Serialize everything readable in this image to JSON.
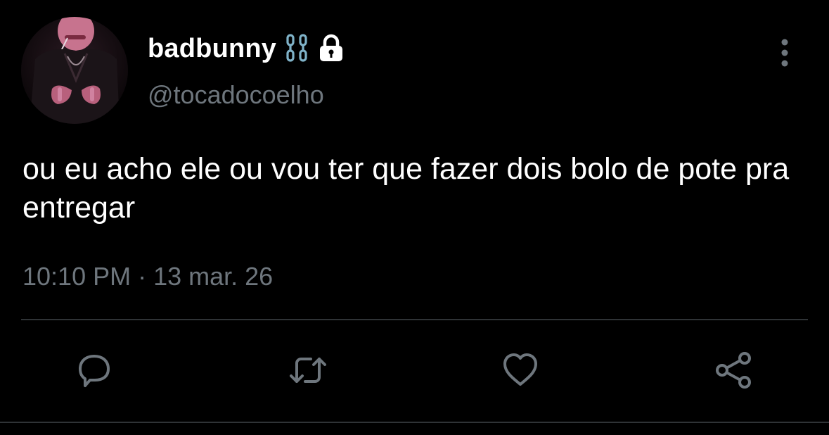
{
  "user": {
    "display_name": "badbunny",
    "name_emoji": "chain-emoji",
    "protected_icon": "lock-icon",
    "handle": "@tocadocoelho"
  },
  "tweet": {
    "text": "ou eu acho ele ou vou ter que fazer dois bolo de pote pra entregar",
    "time": "10:10 PM",
    "separator": " · ",
    "date": "13 mar. 26"
  },
  "icons": {
    "more": "more-vertical-icon",
    "reply": "reply-icon",
    "retweet": "retweet-icon",
    "like": "heart-icon",
    "share": "share-icon"
  },
  "colors": {
    "background": "#000000",
    "primary_text": "#ffffff",
    "secondary_text": "#6e767d",
    "divider": "#2f3336",
    "chain_emoji": "#7fb2c8"
  }
}
